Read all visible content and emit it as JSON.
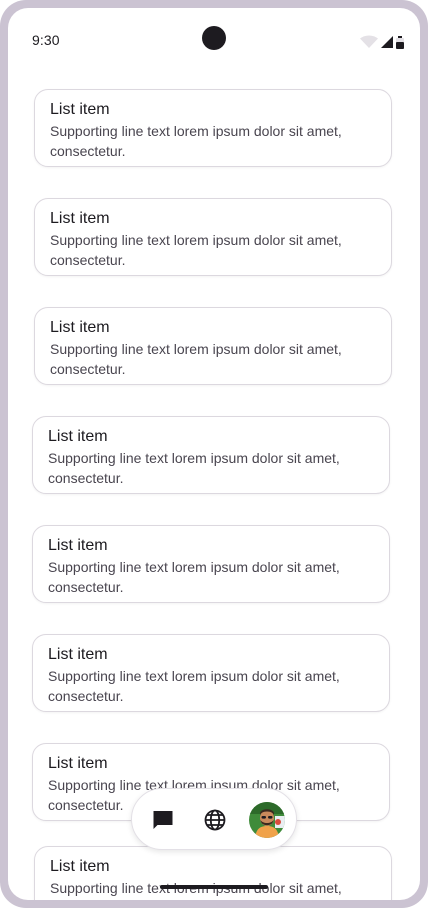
{
  "status_bar": {
    "time": "9:30",
    "icons": [
      "wifi-icon",
      "cellular-signal-icon",
      "battery-icon"
    ]
  },
  "list": {
    "items": [
      {
        "headline": "List item",
        "supporting": "Supporting line text lorem ipsum dolor sit amet, consectetur."
      },
      {
        "headline": "List item",
        "supporting": "Supporting line text lorem ipsum dolor sit amet, consectetur."
      },
      {
        "headline": "List item",
        "supporting": "Supporting line text lorem ipsum dolor sit amet, consectetur."
      },
      {
        "headline": "List item",
        "supporting": "Supporting line text lorem ipsum dolor sit amet, consectetur."
      },
      {
        "headline": "List item",
        "supporting": "Supporting line text lorem ipsum dolor sit amet, consectetur."
      },
      {
        "headline": "List item",
        "supporting": "Supporting line text lorem ipsum dolor sit amet, consectetur."
      },
      {
        "headline": "List item",
        "supporting": "Supporting line text lorem ipsum dolor sit amet, consectetur."
      },
      {
        "headline": "List item",
        "supporting": "Supporting line text lorem ipsum dolor sit amet, consectetur."
      }
    ]
  },
  "floating_toolbar": {
    "buttons": [
      "chat-icon",
      "globe-icon",
      "avatar"
    ]
  },
  "colors": {
    "device_frame": "#cbc3d2",
    "surface": "#ffffff",
    "on_surface": "#1d1b20",
    "on_surface_variant": "#49454f",
    "outline": "#dcd8df"
  }
}
